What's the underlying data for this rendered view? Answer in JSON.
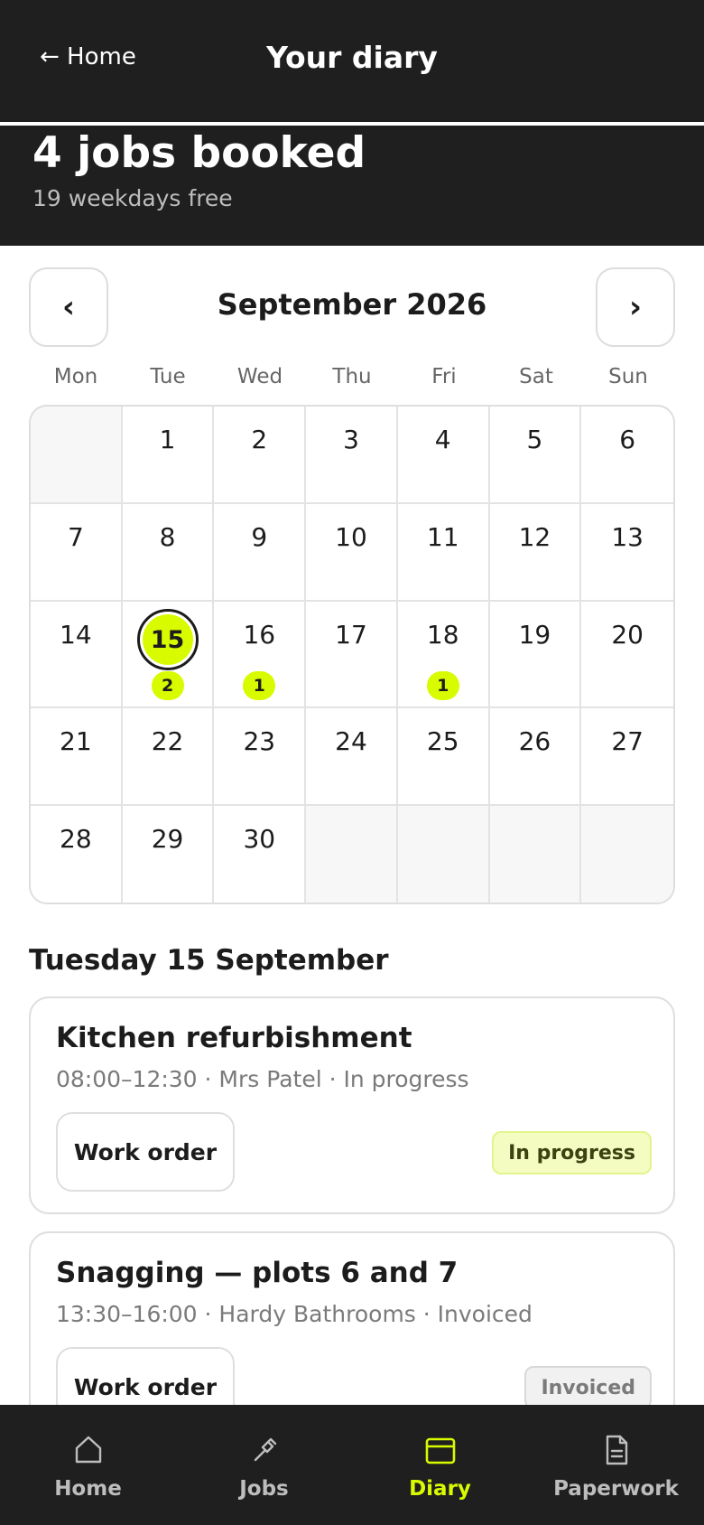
{
  "header": {
    "back_label": "← Home",
    "title": "Your diary"
  },
  "summary": {
    "jobs_booked": "4 jobs booked",
    "weekdays_free": "19 weekdays free"
  },
  "calendar": {
    "prev_label": "‹",
    "next_label": "›",
    "month_label": "September 2026",
    "weekdays": [
      "Mon",
      "Tue",
      "Wed",
      "Thu",
      "Fri",
      "Sat",
      "Sun"
    ],
    "selected_day": "15",
    "selected_count": "2",
    "day16_count": "1",
    "day18_count": "1",
    "days": [
      "1",
      "2",
      "3",
      "4",
      "5",
      "6",
      "7",
      "8",
      "9",
      "10",
      "11",
      "12",
      "13",
      "14",
      "15",
      "16",
      "17",
      "18",
      "19",
      "20",
      "21",
      "22",
      "23",
      "24",
      "25",
      "26",
      "27",
      "28",
      "29",
      "30"
    ]
  },
  "day_section": {
    "heading": "Tuesday 15 September",
    "jobs": [
      {
        "title": "Kitchen refurbishment",
        "meta": "08:00–12:30 · Mrs Patel · In progress",
        "button": "Work order",
        "status": "In progress"
      },
      {
        "title": "Snagging — plots 6 and 7",
        "meta": "13:30–16:00 · Hardy Bathrooms · Invoiced",
        "button": "Work order",
        "status": "Invoiced"
      }
    ]
  },
  "bottom_nav": {
    "items": [
      {
        "label": "Home",
        "icon": "home-icon"
      },
      {
        "label": "Jobs",
        "icon": "hammer-icon"
      },
      {
        "label": "Diary",
        "icon": "calendar-icon"
      },
      {
        "label": "Paperwork",
        "icon": "document-icon"
      }
    ],
    "active": "Diary"
  },
  "colors": {
    "accent": "#d8fb00",
    "dark": "#1f1f1f"
  }
}
